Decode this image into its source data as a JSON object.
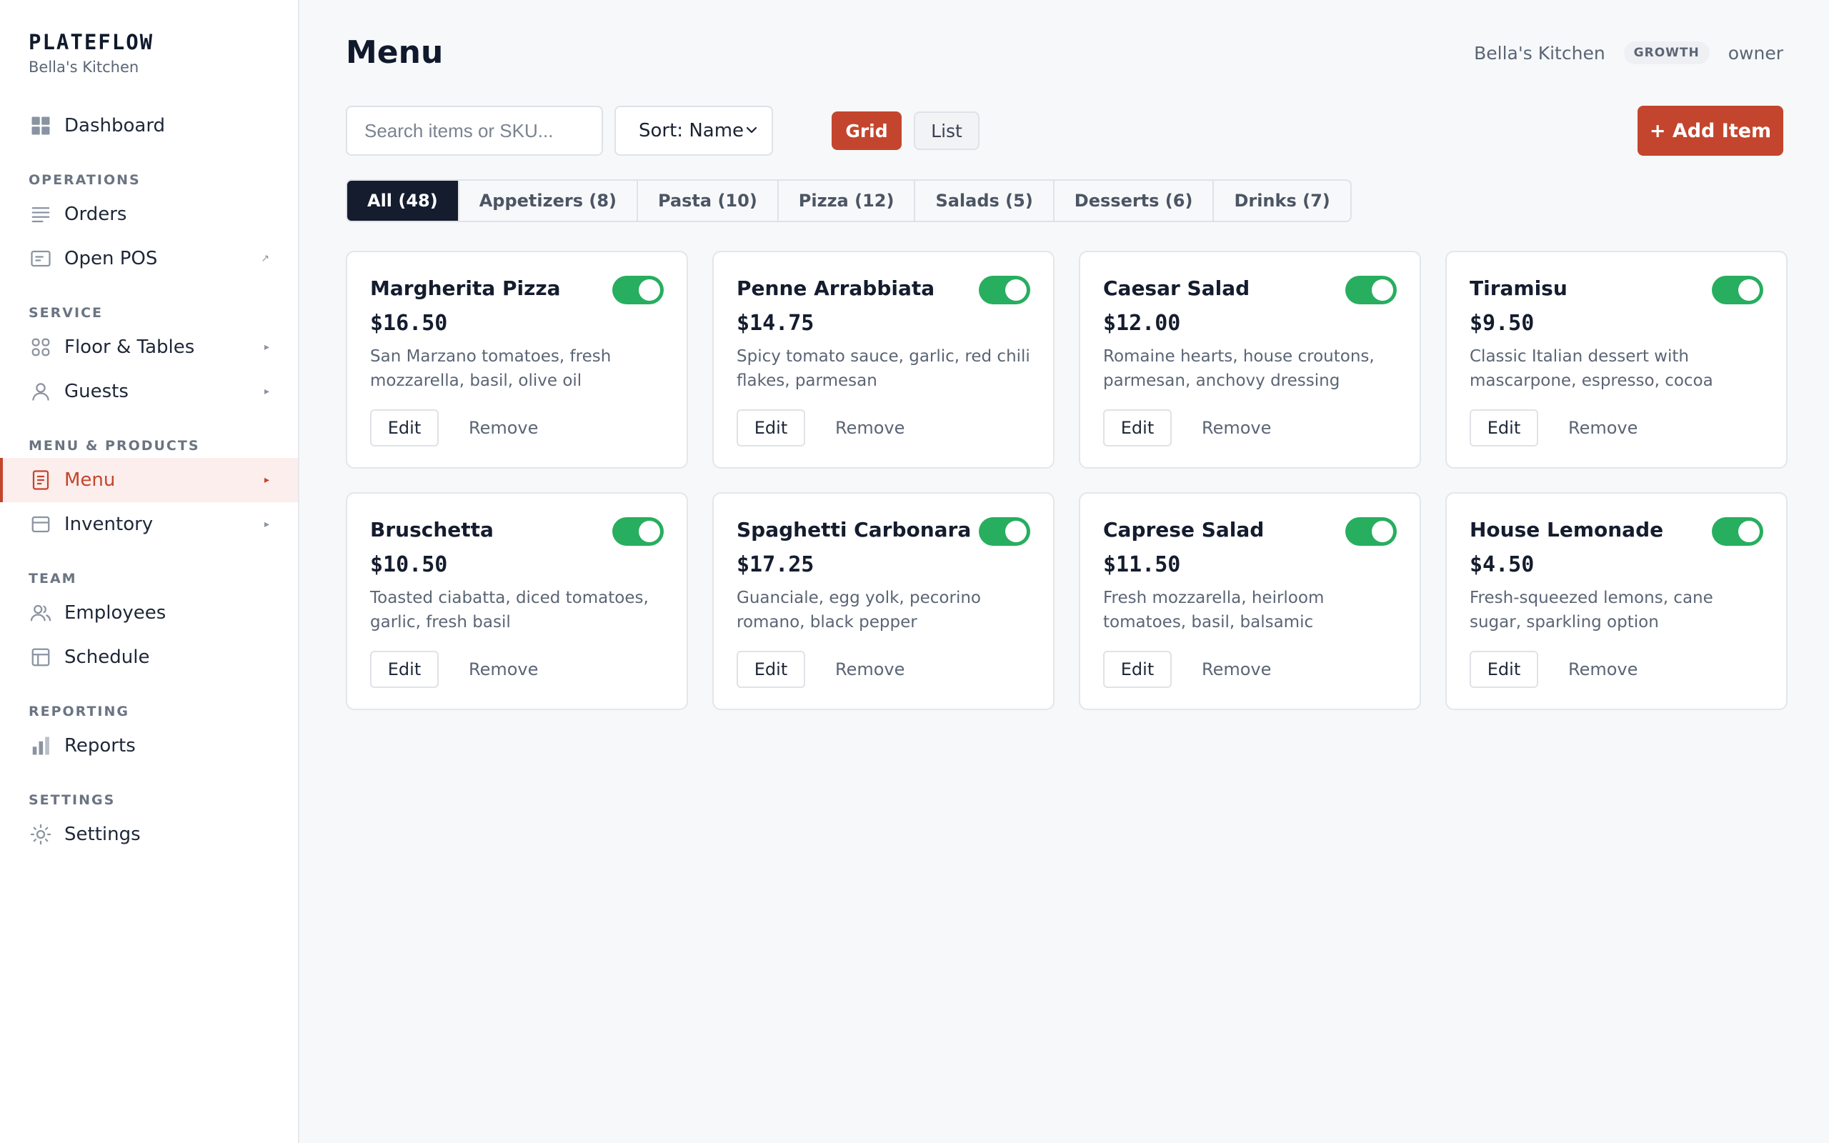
{
  "brand": {
    "name": "PLATEFLOW",
    "subtitle": "Bella's Kitchen"
  },
  "nav": {
    "dashboard": "Dashboard",
    "sections": {
      "operations": "OPERATIONS",
      "service": "SERVICE",
      "menu_products": "MENU & PRODUCTS",
      "team": "TEAM",
      "reporting": "REPORTING",
      "settings": "SETTINGS"
    },
    "items": {
      "orders": "Orders",
      "open_pos": "Open POS",
      "floor_tables": "Floor & Tables",
      "guests": "Guests",
      "menu": "Menu",
      "inventory": "Inventory",
      "employees": "Employees",
      "schedule": "Schedule",
      "reports": "Reports",
      "settings": "Settings"
    },
    "active": "Menu"
  },
  "header": {
    "title": "Menu",
    "restaurant": "Bella's Kitchen",
    "plan": "GROWTH",
    "role": "owner"
  },
  "toolbar": {
    "search_placeholder": "Search items or SKU...",
    "sort_label": "Sort: Name",
    "grid_label": "Grid",
    "list_label": "List",
    "add_label": "+ Add Item",
    "active_view": "Grid"
  },
  "tabs": [
    {
      "label": "All (48)",
      "active": true
    },
    {
      "label": "Appetizers (8)",
      "active": false
    },
    {
      "label": "Pasta (10)",
      "active": false
    },
    {
      "label": "Pizza (12)",
      "active": false
    },
    {
      "label": "Salads (5)",
      "active": false
    },
    {
      "label": "Desserts (6)",
      "active": false
    },
    {
      "label": "Drinks (7)",
      "active": false
    }
  ],
  "card_actions": {
    "edit": "Edit",
    "remove": "Remove"
  },
  "items": [
    {
      "name": "Margherita Pizza",
      "price": "$16.50",
      "description": "San Marzano tomatoes, fresh mozzarella, basil, olive oil",
      "available": true
    },
    {
      "name": "Penne Arrabbiata",
      "price": "$14.75",
      "description": "Spicy tomato sauce, garlic, red chili flakes, parmesan",
      "available": true
    },
    {
      "name": "Caesar Salad",
      "price": "$12.00",
      "description": "Romaine hearts, house croutons, parmesan, anchovy dressing",
      "available": true
    },
    {
      "name": "Tiramisu",
      "price": "$9.50",
      "description": "Classic Italian dessert with mascarpone, espresso, cocoa",
      "available": true
    },
    {
      "name": "Bruschetta",
      "price": "$10.50",
      "description": "Toasted ciabatta, diced tomatoes, garlic, fresh basil",
      "available": true
    },
    {
      "name": "Spaghetti Carbonara",
      "price": "$17.25",
      "description": "Guanciale, egg yolk, pecorino romano, black pepper",
      "available": true
    },
    {
      "name": "Caprese Salad",
      "price": "$11.50",
      "description": "Fresh mozzarella, heirloom tomatoes, basil, balsamic",
      "available": true
    },
    {
      "name": "House Lemonade",
      "price": "$4.50",
      "description": "Fresh-squeezed lemons, cane sugar, sparkling option",
      "available": true
    }
  ],
  "colors": {
    "accent": "#c4452d",
    "toggle_on": "#27ae5f",
    "tab_active": "#141c2e"
  }
}
